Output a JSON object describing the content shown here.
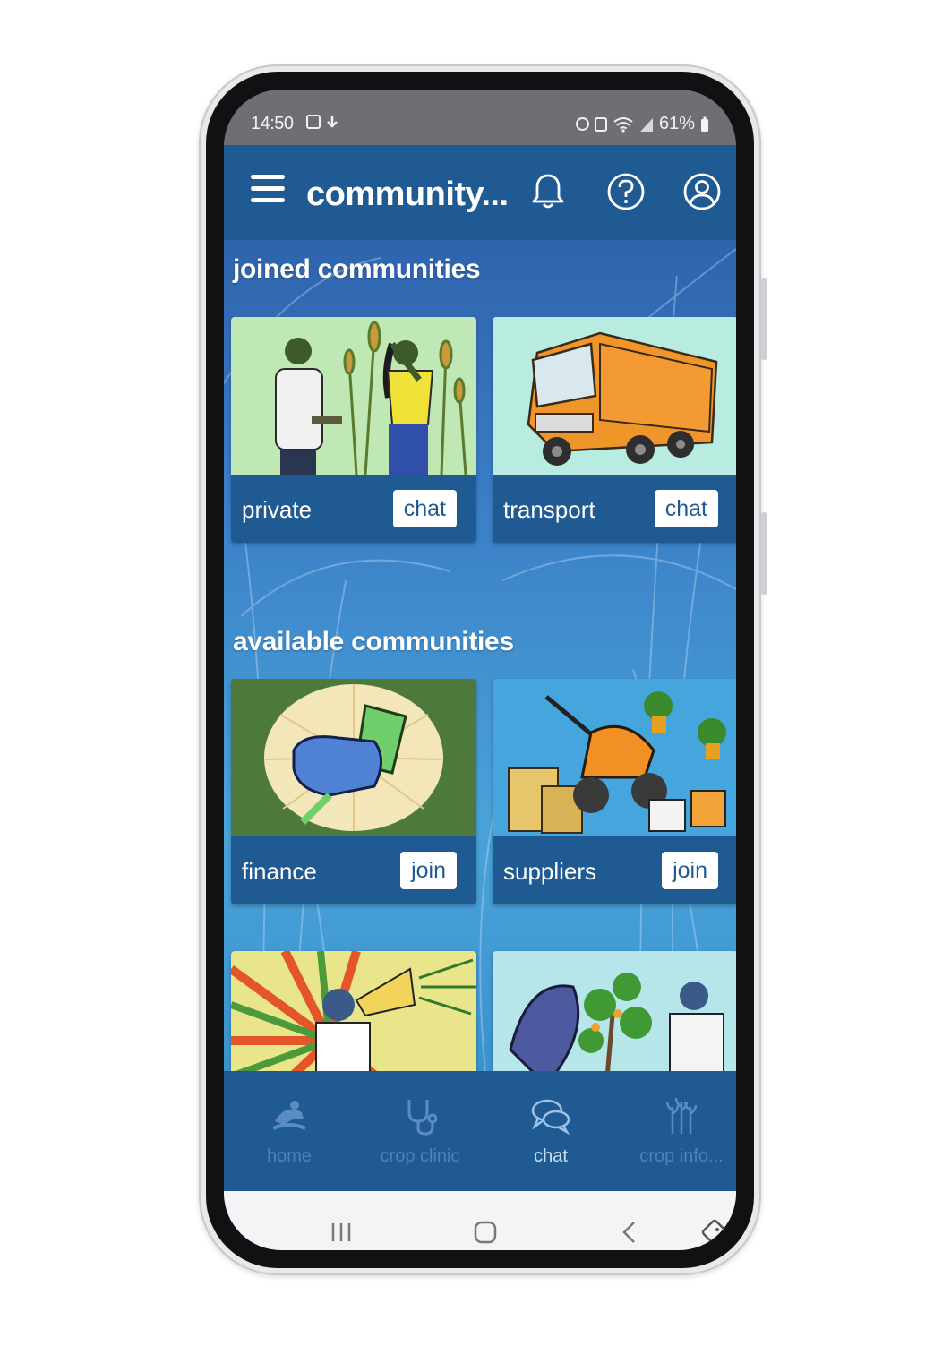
{
  "status_bar": {
    "time": "14:50",
    "battery": "61%"
  },
  "app_bar": {
    "title": "community...",
    "icons": [
      "menu-icon",
      "bell-icon",
      "help-icon",
      "account-icon"
    ]
  },
  "sections": {
    "joined": {
      "title": "joined communities",
      "cards": [
        {
          "label": "private",
          "button": "chat",
          "image": "farmers-with-wheat-illustration"
        },
        {
          "label": "transport",
          "button": "chat",
          "image": "orange-truck-illustration"
        }
      ]
    },
    "available": {
      "title": "available communities",
      "cards": [
        {
          "label": "finance",
          "button": "join",
          "image": "fist-holding-money-illustration"
        },
        {
          "label": "suppliers",
          "button": "join",
          "image": "tiller-and-seed-bags-illustration"
        },
        {
          "image": "man-with-megaphone-illustration"
        },
        {
          "image": "plant-doctor-illustration"
        }
      ]
    }
  },
  "bottom_nav": {
    "items": [
      {
        "label": "home",
        "icon": "home-icon"
      },
      {
        "label": "crop clinic",
        "icon": "stethoscope-icon"
      },
      {
        "label": "chat",
        "icon": "chat-bubbles-icon",
        "active": true
      },
      {
        "label": "crop info...",
        "icon": "crops-icon"
      }
    ]
  },
  "colors": {
    "app_bar": "#205a93",
    "card_footer": "#205a93",
    "status_bar": "#6d6f73",
    "background_top": "#2f63ad",
    "background_bottom": "#4aa3d8"
  }
}
